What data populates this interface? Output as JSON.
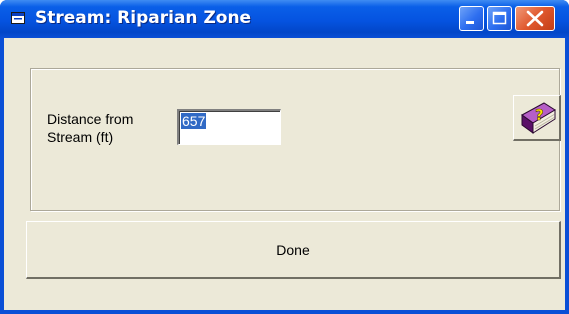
{
  "window": {
    "title": "Stream: Riparian Zone",
    "icon": "app-window-icon",
    "controls": {
      "minimize_icon": "minimize-icon",
      "maximize_icon": "maximize-icon",
      "close_icon": "close-icon"
    }
  },
  "form": {
    "distance_label_line1": "Distance from",
    "distance_label_line2": "Stream (ft)",
    "distance_value": "657",
    "help_icon": "help-book-icon"
  },
  "actions": {
    "done_label": "Done"
  },
  "colors": {
    "titlebar": "#0553e0",
    "client_bg": "#ece9d8",
    "selection": "#316ac5",
    "close_button": "#e0582e",
    "book": "#7a1f8a"
  }
}
